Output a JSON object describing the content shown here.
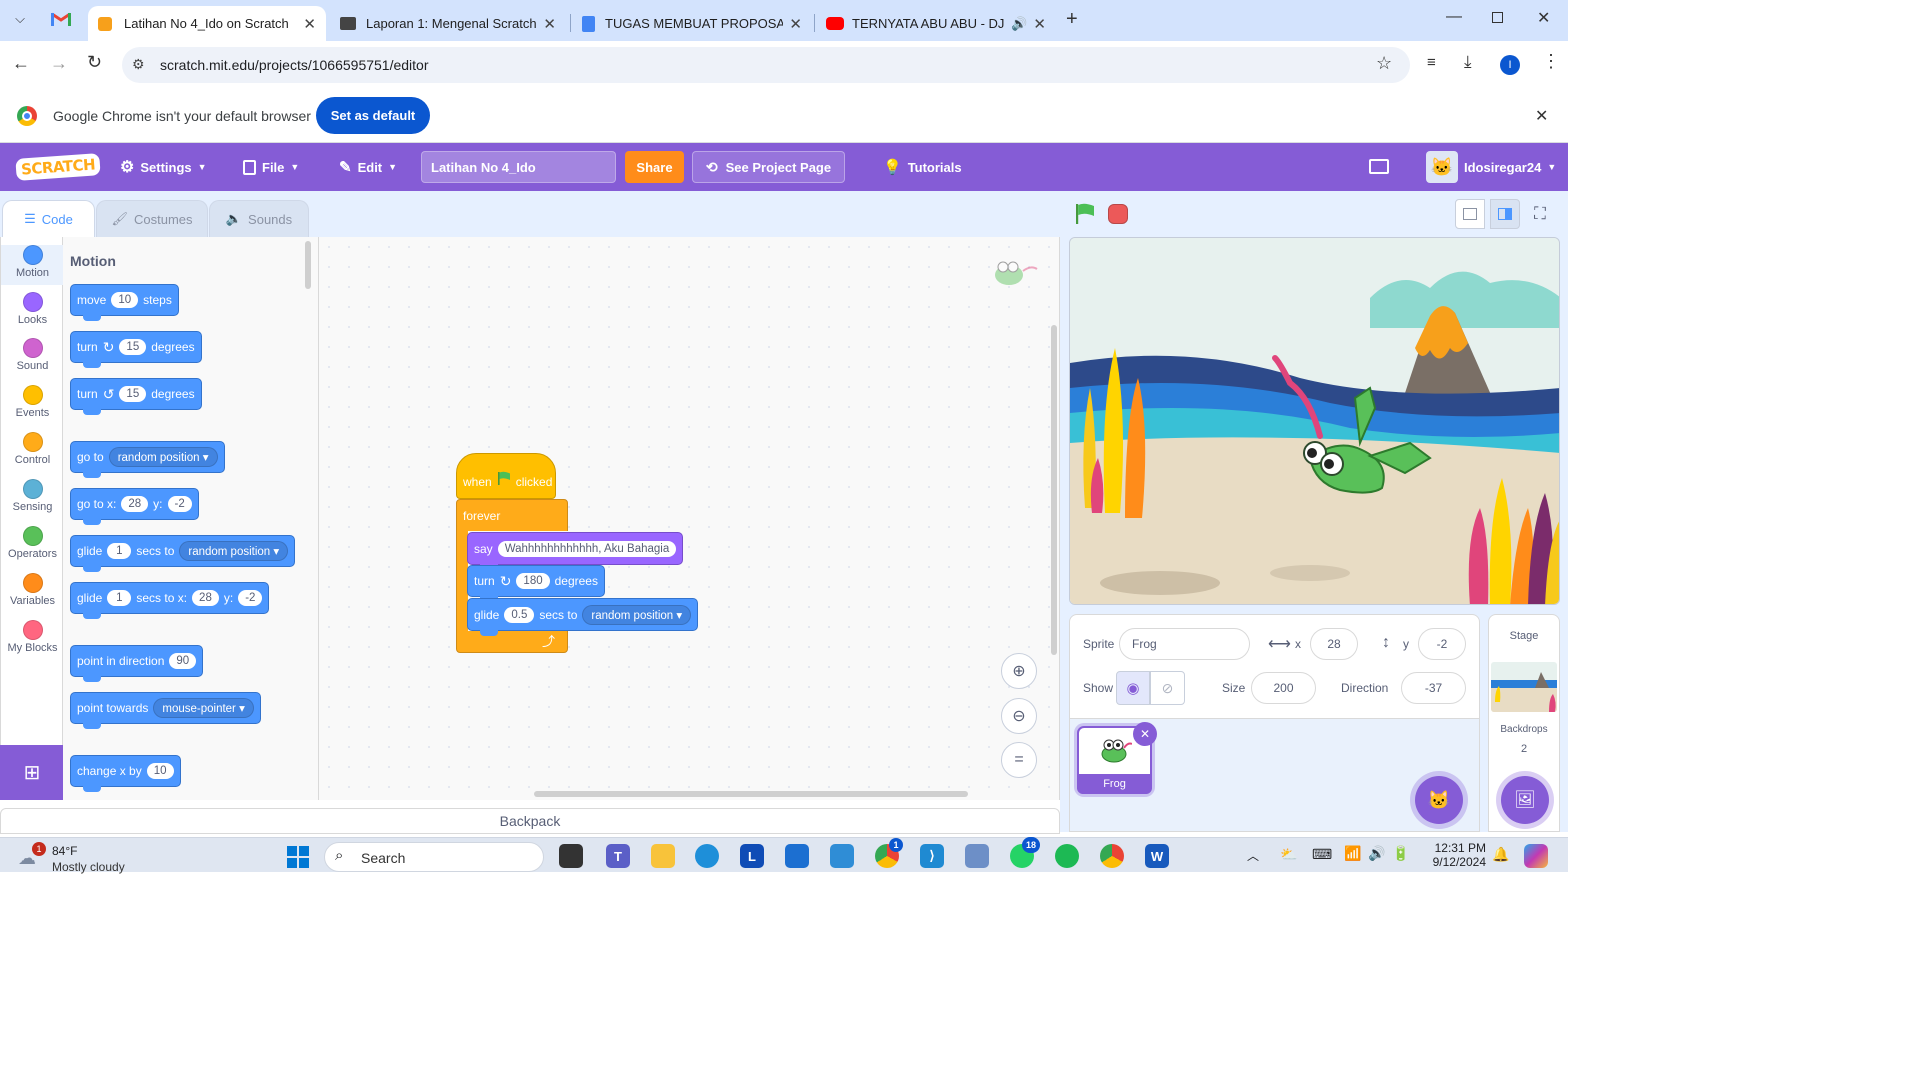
{
  "browser": {
    "tabs": [
      {
        "title": "Latihan No 4_Ido on Scratch",
        "icon": "scratch-favicon",
        "color": "#f7a01b"
      },
      {
        "title": "Laporan 1: Mengenal Scratch",
        "icon": "classroom-favicon",
        "color": "#444444"
      },
      {
        "title": "TUGAS MEMBUAT PROPOSAL I",
        "icon": "docs-favicon",
        "color": "#4285f4"
      },
      {
        "title": "TERNYATA ABU ABU - DJ Q",
        "icon": "youtube-favicon",
        "color": "#ff0000"
      }
    ],
    "url": "scratch.mit.edu/projects/1066595751/editor",
    "profile_initial": "I",
    "infobar_message": "Google Chrome isn't your default browser",
    "infobar_button": "Set as default"
  },
  "scratch": {
    "menu": {
      "logo": "SCRATCH",
      "settings": "Settings",
      "file": "File",
      "edit": "Edit",
      "project_title": "Latihan No 4_Ido",
      "share": "Share",
      "see_project_page": "See Project Page",
      "tutorials": "Tutorials",
      "username": "Idosiregar24"
    },
    "editor_tabs": {
      "code": "Code",
      "costumes": "Costumes",
      "sounds": "Sounds"
    },
    "categories": [
      {
        "label": "Motion",
        "color": "#4c97ff"
      },
      {
        "label": "Looks",
        "color": "#9966ff"
      },
      {
        "label": "Sound",
        "color": "#cf63cf"
      },
      {
        "label": "Events",
        "color": "#ffbf00"
      },
      {
        "label": "Control",
        "color": "#ffab19"
      },
      {
        "label": "Sensing",
        "color": "#5cb1d6"
      },
      {
        "label": "Operators",
        "color": "#59c059"
      },
      {
        "label": "Variables",
        "color": "#ff8c1a"
      },
      {
        "label": "My Blocks",
        "color": "#ff6680"
      }
    ],
    "palette": {
      "heading": "Motion",
      "move": {
        "a": "move",
        "n": "10",
        "b": "steps"
      },
      "turn_right": {
        "a": "turn",
        "n": "15",
        "b": "degrees"
      },
      "turn_left": {
        "a": "turn",
        "n": "15",
        "b": "degrees"
      },
      "goto": {
        "a": "go to",
        "opt": "random position"
      },
      "gotoxy": {
        "a": "go to x:",
        "x": "28",
        "b": "y:",
        "y": "-2"
      },
      "glide_to": {
        "a": "glide",
        "n": "1",
        "b": "secs to",
        "opt": "random position"
      },
      "glide_xy": {
        "a": "glide",
        "n": "1",
        "b": "secs to x:",
        "x": "28",
        "c": "y:",
        "y": "-2"
      },
      "point_dir": {
        "a": "point in direction",
        "n": "90"
      },
      "point_towards": {
        "a": "point towards",
        "opt": "mouse-pointer"
      },
      "change_x": {
        "a": "change x by",
        "n": "10"
      }
    },
    "script": {
      "hat_when": "when",
      "hat_clicked": "clicked",
      "forever": "forever",
      "say_label": "say",
      "say_text": "Wahhhhhhhhhhhh, Aku Bahagia",
      "turn_label": "turn",
      "turn_deg": "180",
      "turn_unit": "degrees",
      "glide_label": "glide",
      "glide_secs": "0.5",
      "glide_secs_to": "secs to",
      "glide_target": "random position"
    },
    "backpack": "Backpack",
    "sprite_info": {
      "sprite_label": "Sprite",
      "sprite_name": "Frog",
      "x_label": "x",
      "x": "28",
      "y_label": "y",
      "y": "-2",
      "show_label": "Show",
      "size_label": "Size",
      "size": "200",
      "direction_label": "Direction",
      "direction": "-37"
    },
    "sprites": [
      {
        "name": "Frog"
      }
    ],
    "stage_panel": {
      "title": "Stage",
      "backdrops_label": "Backdrops",
      "backdrops_count": "2"
    }
  },
  "taskbar": {
    "weather_temp": "84°F",
    "weather_desc": "Mostly cloudy",
    "weather_badge": "1",
    "search": "Search",
    "time": "12:31 PM",
    "date": "9/12/2024",
    "whatsapp_badge": "18",
    "chrome_badge": "1"
  }
}
